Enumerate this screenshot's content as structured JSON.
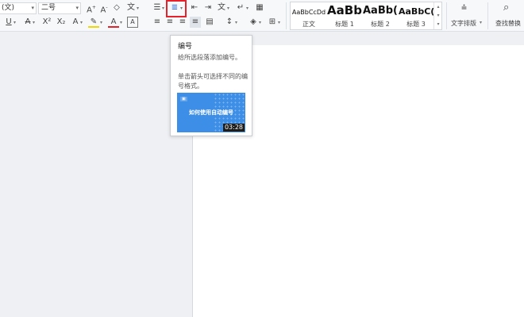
{
  "ribbon": {
    "font_name": "(文)",
    "font_size": "二号",
    "styles": [
      {
        "preview": "AaBbCcDd",
        "label": "正文"
      },
      {
        "preview": "AaBb",
        "label": "标题 1"
      },
      {
        "preview": "AaBb(",
        "label": "标题 2"
      },
      {
        "preview": "AaBbC(",
        "label": "标题 3"
      }
    ],
    "text_layout_label": "文字排版",
    "find_replace_label": "查找替换"
  },
  "tooltip": {
    "title": "编号",
    "description": "给所选段落添加编号。",
    "hint": "单击箭头可选择不同的编号格式。",
    "video_title": "如何使用自动编号",
    "video_duration": "03:28"
  },
  "colors": {
    "highlight_border": "#e5222b",
    "video_bg": "#3d8ee6",
    "accent": "#2e6bd8"
  }
}
